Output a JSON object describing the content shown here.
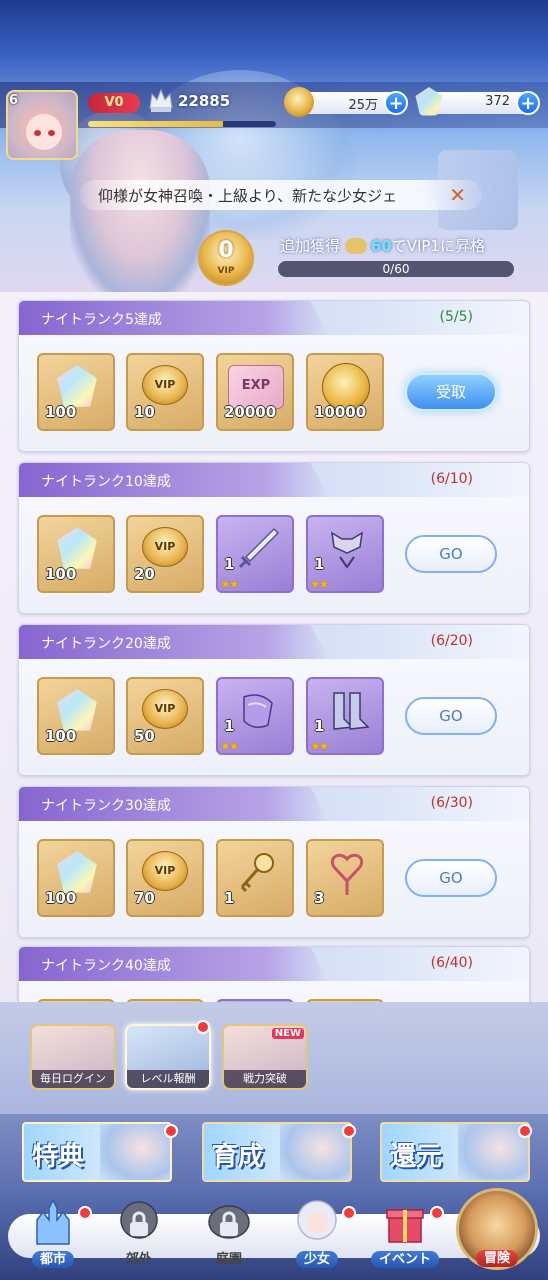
{
  "header": {
    "level": "6",
    "vip_level": "V0",
    "power": "22885",
    "exp_fraction": 0.72,
    "gold": "25万",
    "gems": "372"
  },
  "marquee": {
    "text": "仰様が女神召喚・上級より、新たな少女ジェ",
    "close_icon": "close-x-icon"
  },
  "vip": {
    "current": "0",
    "label": "VIP",
    "bonus_prefix": "追加獲得",
    "bonus_amount": "60",
    "bonus_mid": "で",
    "bonus_target": "VIP1",
    "bonus_suffix": "に昇格",
    "progress_text": "0/60",
    "progress_fraction": 0
  },
  "rewards": [
    {
      "title": "ナイトランク5達成",
      "progress": "(5/5)",
      "button": "受取",
      "items": [
        {
          "type": "gem",
          "qty": "100"
        },
        {
          "type": "vip",
          "label": "VIP",
          "qty": "10"
        },
        {
          "type": "exp",
          "label": "EXP",
          "qty": "20000"
        },
        {
          "type": "coin",
          "qty": "10000"
        }
      ]
    },
    {
      "title": "ナイトランク10達成",
      "progress": "(6/10)",
      "button": "GO",
      "items": [
        {
          "type": "gem",
          "qty": "100"
        },
        {
          "type": "vip",
          "label": "VIP",
          "qty": "20"
        },
        {
          "type": "weapon",
          "qty": "1",
          "stars": "★★"
        },
        {
          "type": "armor",
          "qty": "1",
          "stars": "★★"
        }
      ]
    },
    {
      "title": "ナイトランク20達成",
      "progress": "(6/20)",
      "button": "GO",
      "items": [
        {
          "type": "gem",
          "qty": "100"
        },
        {
          "type": "vip",
          "label": "VIP",
          "qty": "50"
        },
        {
          "type": "gloves",
          "qty": "1",
          "stars": "★★"
        },
        {
          "type": "boots",
          "qty": "1",
          "stars": "★★"
        }
      ]
    },
    {
      "title": "ナイトランク30達成",
      "progress": "(6/30)",
      "button": "GO",
      "items": [
        {
          "type": "gem",
          "qty": "100"
        },
        {
          "type": "vip",
          "label": "VIP",
          "qty": "70"
        },
        {
          "type": "key",
          "qty": "1"
        },
        {
          "type": "charm",
          "qty": "3"
        }
      ]
    },
    {
      "title": "ナイトランク40達成",
      "progress": "(6/40)"
    }
  ],
  "event_tabs": [
    {
      "label": "毎日ログイン"
    },
    {
      "label": "レベル報酬"
    },
    {
      "label": "戦力突破",
      "badge": "NEW"
    }
  ],
  "features": [
    {
      "label": "特典"
    },
    {
      "label": "育成"
    },
    {
      "label": "還元"
    }
  ],
  "nav": [
    {
      "label": "都市"
    },
    {
      "label": "郊外"
    },
    {
      "label": "庭園"
    },
    {
      "label": "少女"
    },
    {
      "label": "イベント"
    },
    {
      "label": "冒険"
    }
  ],
  "colors": {
    "accent_blue": "#3f8ff0",
    "tab_purple": "#8765cf",
    "progress_done": "#2d8a3e",
    "progress_todo": "#c0302a",
    "badge_red": "#ef3b3b"
  }
}
